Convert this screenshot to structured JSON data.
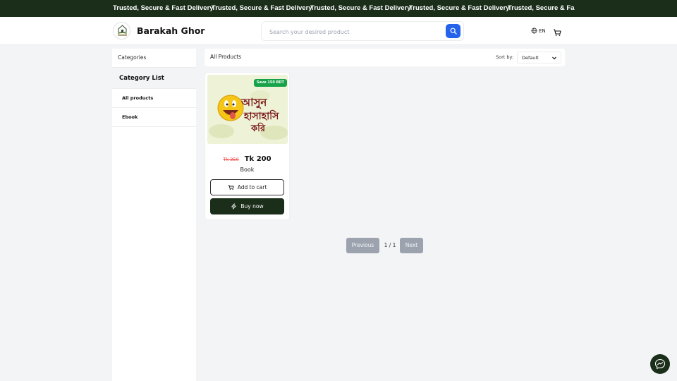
{
  "ticker": {
    "items": [
      "Trusted, Secure & Fast Delivery",
      "Trusted, Secure & Fast Delivery",
      "Trusted, Secure & Fast Delivery",
      "Trusted, Secure & Fast Delivery",
      "Trusted, Secure & Fa"
    ]
  },
  "header": {
    "brand": "Barakah Ghor",
    "search_placeholder": "Search your desired product",
    "language": "EN"
  },
  "sidebar": {
    "title": "Categories",
    "list_heading": "Category List",
    "items": [
      "All products",
      "Ebook"
    ]
  },
  "toolbar": {
    "title": "All Products",
    "sort_label": "Sort by:",
    "sort_value": "Default"
  },
  "product": {
    "badge": "Save 150 BDT",
    "old_price": "Tk 350",
    "price": "Tk 200",
    "name": "Book",
    "add_to_cart": "Add to cart",
    "buy_now": "Buy now"
  },
  "pagination": {
    "previous": "Previous",
    "page_info": "1 / 1",
    "next": "Next"
  },
  "colors": {
    "brand_dark": "#1a2e1a",
    "accent_blue": "#2563eb",
    "badge_green": "#16a34a",
    "old_price_red": "#ef4444"
  },
  "icons": {
    "search": "search-icon",
    "globe": "globe-icon",
    "cart": "cart-icon",
    "bolt": "bolt-icon",
    "chevron": "chevron-down-icon",
    "messenger": "messenger-icon"
  }
}
